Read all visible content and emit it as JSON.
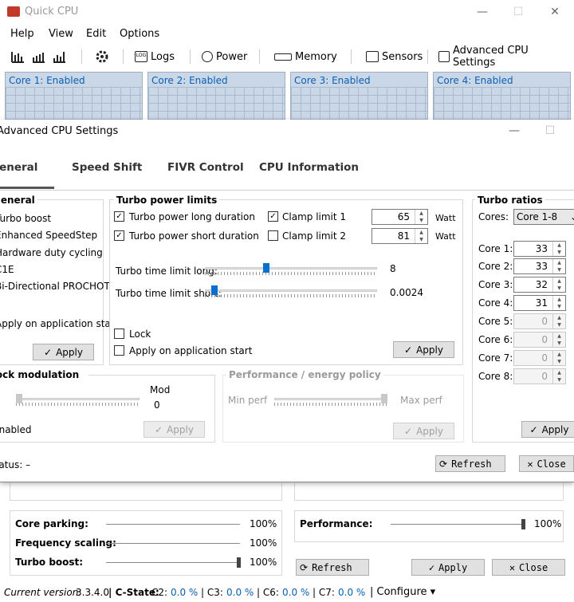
{
  "window": {
    "title": "Quick CPU",
    "minimize": "—",
    "maximize": "☐",
    "close": "✕"
  },
  "menu": [
    "Help",
    "View",
    "Edit",
    "Options"
  ],
  "toolbar": {
    "logs": "Logs",
    "power": "Power",
    "memory": "Memory",
    "sensors": "Sensors",
    "advanced": "Advanced CPU Settings"
  },
  "cores": [
    "Core 1: Enabled",
    "Core 2: Enabled",
    "Core 3: Enabled",
    "Core 4: Enabled"
  ],
  "dialog": {
    "title": "Advanced CPU Settings",
    "close": "✕",
    "tabs": [
      "General",
      "Speed Shift",
      "FIVR Control",
      "CPU Information"
    ],
    "general": {
      "title": "General",
      "items": [
        "Turbo boost",
        "Enhanced SpeedStep",
        "Hardware duty cycling",
        "C1E",
        "Bi-Directional PROCHOT"
      ],
      "apply_start": "Apply on application start",
      "apply": "Apply"
    },
    "turbo_power": {
      "title": "Turbo power limits",
      "long": "Turbo power long duration",
      "short": "Turbo power short duration",
      "clamp1": "Clamp limit 1",
      "clamp2": "Clamp limit 2",
      "val1": "65",
      "val2": "81",
      "unit": "Watt",
      "time_long": "Turbo time limit long:",
      "time_short": "Turbo time limit short:",
      "time_long_val": "8",
      "time_short_val": "0.0024",
      "time_long_frac": 0.35,
      "time_short_frac": 0.04,
      "lock": "Lock",
      "apply_start": "Apply on application start",
      "apply": "Apply"
    },
    "turbo_ratios": {
      "title": "Turbo ratios",
      "cores_label": "Cores:",
      "cores_select": "Core 1-8",
      "rows": [
        {
          "label": "Core 1:",
          "value": "33"
        },
        {
          "label": "Core 2:",
          "value": "33"
        },
        {
          "label": "Core 3:",
          "value": "32"
        },
        {
          "label": "Core 4:",
          "value": "31"
        },
        {
          "label": "Core 5:",
          "value": "0"
        },
        {
          "label": "Core 6:",
          "value": "0"
        },
        {
          "label": "Core 7:",
          "value": "0"
        },
        {
          "label": "Core 8:",
          "value": "0"
        }
      ],
      "apply": "Apply"
    },
    "clock_mod": {
      "title": "Clock modulation",
      "mod_label": "Mod",
      "mod_value": "0",
      "enabled": "Enabled",
      "apply": "Apply"
    },
    "perf": {
      "title": "Performance / energy policy",
      "min": "Min perf",
      "max": "Max perf",
      "apply": "Apply"
    },
    "status": "Status: –",
    "refresh": "Refresh",
    "close_btn": "Close"
  },
  "bottom": {
    "rows": [
      {
        "label": "Core parking:",
        "value": "100%"
      },
      {
        "label": "Frequency scaling:",
        "value": "100%"
      },
      {
        "label": "Turbo boost:",
        "value": "100%"
      }
    ],
    "performance": {
      "label": "Performance:",
      "value": "100%"
    },
    "refresh": "Refresh",
    "apply": "Apply",
    "close": "Close"
  },
  "status": {
    "version_label": "Current version:",
    "version": "3.3.4.0",
    "cstate": "C-State:",
    "c2": "C2:",
    "c2v": "0.0 %",
    "c3": "C3:",
    "c3v": "0.0 %",
    "c6": "C6:",
    "c6v": "0.0 %",
    "c7": "C7:",
    "c7v": "0.0 %",
    "configure": "Configure"
  }
}
